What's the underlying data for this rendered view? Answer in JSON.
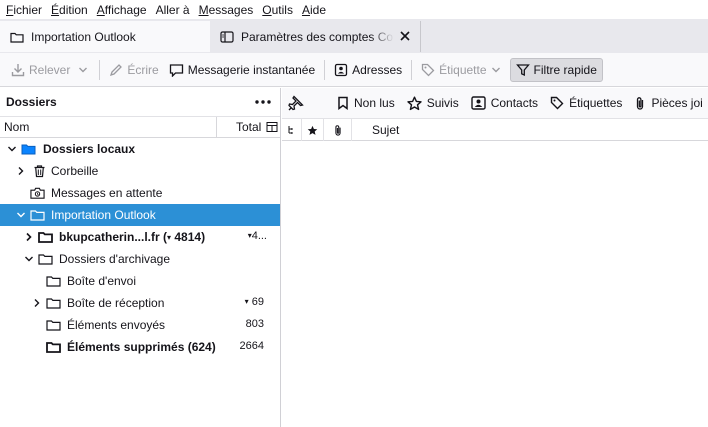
{
  "menu": {
    "items": [
      {
        "accel": "F",
        "rest": "ichier"
      },
      {
        "accel": "É",
        "rest": "dition"
      },
      {
        "accel": "A",
        "rest": "ffichage"
      },
      {
        "accel": "A",
        "rest": "ller à",
        "accel_after": true
      },
      {
        "accel": "M",
        "rest": "essages"
      },
      {
        "accel": "O",
        "rest": "utils"
      },
      {
        "accel": "A",
        "rest": "ide"
      }
    ],
    "fichier": "Fichier",
    "edition": "Édition",
    "affichage": "Affichage",
    "aller": "Aller à",
    "messages": "Messages",
    "outils": "Outils",
    "aide": "Aide"
  },
  "tabs": {
    "active_label": "Importation Outlook",
    "inactive_label": "Paramètres des comptes Co"
  },
  "toolbar": {
    "relever": "Relever",
    "ecrire": "Écrire",
    "messagerie": "Messagerie instantanée",
    "adresses": "Adresses",
    "etiquette": "Étiquette",
    "filtre": "Filtre rapide"
  },
  "folder_pane": {
    "title": "Dossiers",
    "col_name": "Nom",
    "col_total": "Total",
    "rows": {
      "dossiers_locaux": "Dossiers locaux",
      "corbeille": "Corbeille",
      "messages_attente": "Messages en attente",
      "importation_outlook": "Importation Outlook",
      "bkup": "bkupcatherin...l.fr (",
      "bkup_unread": "4814)",
      "bkup_total": "4...",
      "dossiers_archivage": "Dossiers d'archivage",
      "boite_envoi": "Boîte d'envoi",
      "boite_reception": "Boîte de réception",
      "boite_reception_total": "69",
      "elements_envoyes": "Éléments envoyés",
      "elements_envoyes_total": "803",
      "elements_supprimes": "Éléments supprimés (624)",
      "elements_supprimes_total": "2664"
    }
  },
  "quick_filter": {
    "non_lus": "Non lus",
    "suivis": "Suivis",
    "contacts": "Contacts",
    "etiquettes": "Étiquettes",
    "pieces_jointes": "Pièces joi"
  },
  "thread_header": {
    "sujet": "Sujet"
  },
  "colors": {
    "selection": "#2c90d6",
    "folder_blue": "#0a84ff",
    "chrome_bg": "#f9f9fb",
    "tabbar_bg": "#e8e8ed"
  }
}
